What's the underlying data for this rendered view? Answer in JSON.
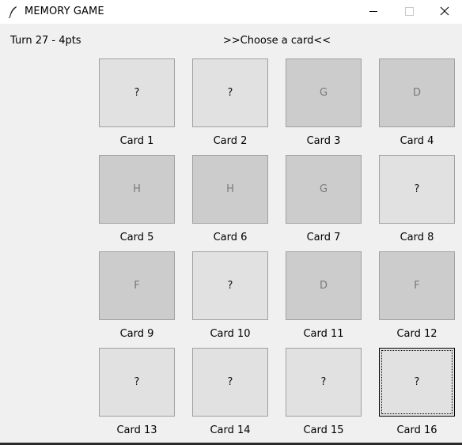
{
  "window": {
    "title": "MEMORY GAME",
    "icon": "feather-icon",
    "controls": [
      "minimize",
      "maximize",
      "close"
    ]
  },
  "status": {
    "turn_text": "Turn 27 - 4pts",
    "prompt": ">>Choose a card<<"
  },
  "cards": [
    {
      "label": "Card 1",
      "face": "?",
      "state": "hidden"
    },
    {
      "label": "Card 2",
      "face": "?",
      "state": "hidden"
    },
    {
      "label": "Card 3",
      "face": "G",
      "state": "revealed"
    },
    {
      "label": "Card 4",
      "face": "D",
      "state": "revealed"
    },
    {
      "label": "Card 5",
      "face": "H",
      "state": "revealed"
    },
    {
      "label": "Card 6",
      "face": "H",
      "state": "revealed"
    },
    {
      "label": "Card 7",
      "face": "G",
      "state": "revealed"
    },
    {
      "label": "Card 8",
      "face": "?",
      "state": "hidden"
    },
    {
      "label": "Card 9",
      "face": "F",
      "state": "revealed"
    },
    {
      "label": "Card 10",
      "face": "?",
      "state": "hidden"
    },
    {
      "label": "Card 11",
      "face": "D",
      "state": "revealed"
    },
    {
      "label": "Card 12",
      "face": "F",
      "state": "revealed"
    },
    {
      "label": "Card 13",
      "face": "?",
      "state": "hidden"
    },
    {
      "label": "Card 14",
      "face": "?",
      "state": "hidden"
    },
    {
      "label": "Card 15",
      "face": "?",
      "state": "hidden"
    },
    {
      "label": "Card 16",
      "face": "?",
      "state": "hidden",
      "focused": true
    }
  ]
}
